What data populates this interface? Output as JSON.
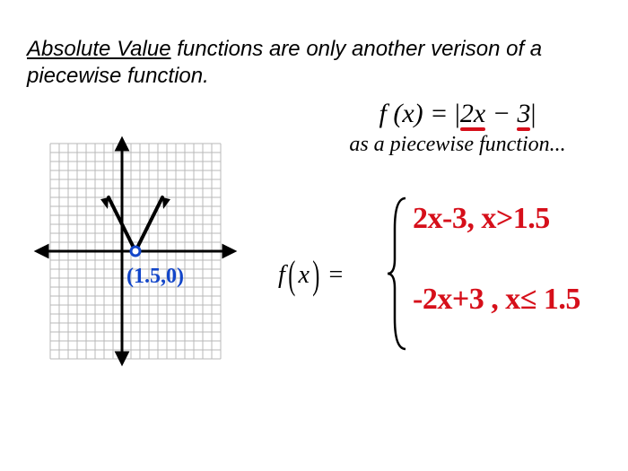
{
  "intro": {
    "heading": "Absolute Value",
    "body_after": " functions are only another verison of a piecewise function."
  },
  "equation": {
    "prefix": "f (x) = ",
    "bar1": "|",
    "term1": "2x",
    "minus": " − ",
    "term2": "3",
    "bar2": "|",
    "subtitle": "as a piecewise function..."
  },
  "graph": {
    "vertex_label": "(1.5,0)"
  },
  "piecewise": {
    "fx_f": "f",
    "fx_x": "x",
    "eq": " = ",
    "line1": "2x-3,  x>1.5",
    "line2": "-2x+3 , x≤ 1.5"
  }
}
